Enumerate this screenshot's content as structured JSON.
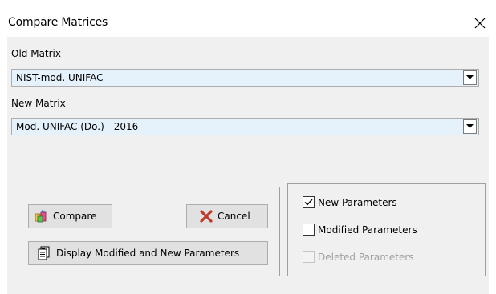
{
  "window": {
    "title": "Compare Matrices",
    "close_glyph": "✕"
  },
  "old_matrix": {
    "label": "Old Matrix",
    "value": "NIST-mod. UNIFAC"
  },
  "new_matrix": {
    "label": "New Matrix",
    "value": "Mod. UNIFAC (Do.) - 2016"
  },
  "buttons": {
    "compare": "Compare",
    "cancel": "Cancel",
    "display": "Display Modified and New Parameters"
  },
  "options": {
    "new_parameters": {
      "label": "New Parameters",
      "checked": true
    },
    "modified_parameters": {
      "label": "Modified Parameters",
      "checked": false
    },
    "deleted_parameters": {
      "label": "Deleted Parameters",
      "checked": false,
      "disabled": true
    }
  },
  "colors": {
    "combo_bg": "#e5f1fb",
    "dialog_bg": "#f0f0f0",
    "cancel_icon": "#c0392b"
  },
  "icons": {
    "compare": "compare-icon",
    "cancel": "red-x-icon",
    "display": "document-list-icon",
    "dropdown": "chevron-down-icon"
  }
}
